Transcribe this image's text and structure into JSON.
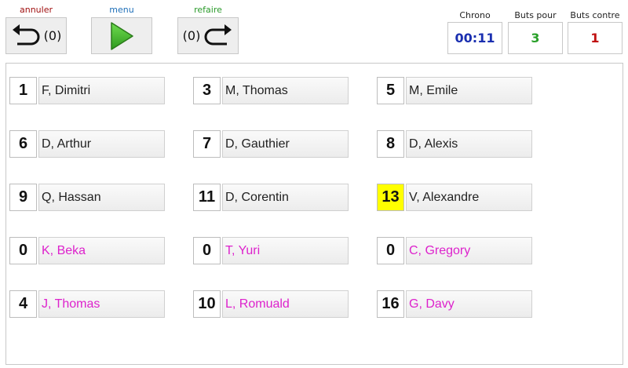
{
  "toolbar": {
    "undo_label": "annuler",
    "undo_count": "(0)",
    "menu_label": "menu",
    "redo_label": "refaire",
    "redo_count": "(0)"
  },
  "stats": {
    "chrono_label": "Chrono",
    "chrono_value": "00:11",
    "goals_for_label": "Buts pour",
    "goals_for_value": "3",
    "goals_against_label": "Buts contre",
    "goals_against_value": "1"
  },
  "colors": {
    "undo": "#a01010",
    "menu": "#1e6fb8",
    "redo": "#2a9a2a",
    "chrono": "#1a2fb0",
    "goals_for": "#2aa02a",
    "goals_against": "#c01010",
    "substitute_name": "#dd22cc",
    "highlight": "#ffff00"
  },
  "players": [
    {
      "number": "1",
      "name": "F, Dimitri"
    },
    {
      "number": "3",
      "name": "M, Thomas"
    },
    {
      "number": "5",
      "name": "M, Emile"
    },
    {
      "number": "6",
      "name": "D, Arthur"
    },
    {
      "number": "7",
      "name": "D, Gauthier"
    },
    {
      "number": "8",
      "name": "D, Alexis"
    },
    {
      "number": "9",
      "name": "Q, Hassan"
    },
    {
      "number": "11",
      "name": "D, Corentin"
    },
    {
      "number": "13",
      "name": "V, Alexandre"
    },
    {
      "number": "0",
      "name": "K, Beka"
    },
    {
      "number": "0",
      "name": "T, Yuri"
    },
    {
      "number": "0",
      "name": "C, Gregory"
    },
    {
      "number": "4",
      "name": "J, Thomas"
    },
    {
      "number": "10",
      "name": "L, Romuald"
    },
    {
      "number": "16",
      "name": "G, Davy"
    }
  ]
}
